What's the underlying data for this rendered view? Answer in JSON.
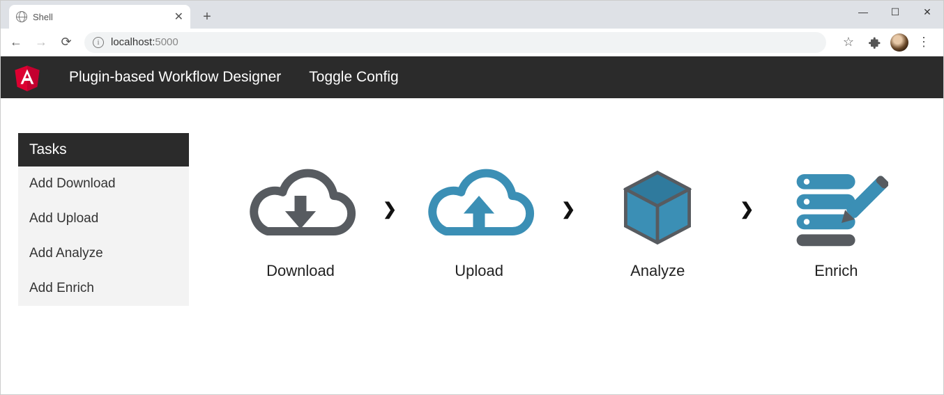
{
  "browser": {
    "tab_title": "Shell",
    "url_host": "localhost:",
    "url_port": "5000"
  },
  "navbar": {
    "brand": "Plugin-based Workflow Designer",
    "toggle": "Toggle Config"
  },
  "sidebar": {
    "header": "Tasks",
    "items": [
      {
        "label": "Add Download"
      },
      {
        "label": "Add Upload"
      },
      {
        "label": "Add Analyze"
      },
      {
        "label": "Add Enrich"
      }
    ]
  },
  "workflow": {
    "steps": [
      {
        "label": "Download",
        "icon": "cloud-download-icon"
      },
      {
        "label": "Upload",
        "icon": "cloud-upload-icon"
      },
      {
        "label": "Analyze",
        "icon": "cube-icon"
      },
      {
        "label": "Enrich",
        "icon": "database-edit-icon"
      }
    ]
  }
}
